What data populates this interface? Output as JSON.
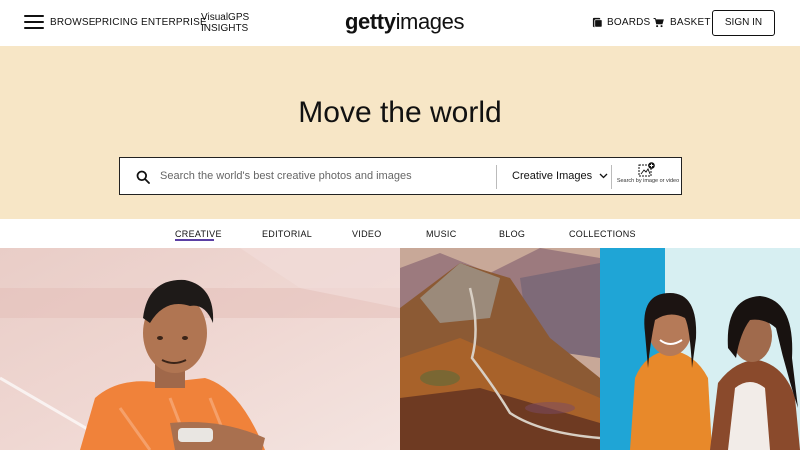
{
  "header": {
    "nav": [
      "BROWSE",
      "PRICING",
      "ENTERPRISE"
    ],
    "visual_gps": [
      "VisualGPS",
      "INSIGHTS"
    ],
    "logo_bold": "getty",
    "logo_light": "images",
    "boards_label": "BOARDS",
    "basket_label": "BASKET",
    "sign_in_label": "SIGN IN"
  },
  "hero": {
    "title": "Move the world",
    "search_placeholder": "Search the world's best creative photos and images",
    "search_type": "Creative Images",
    "image_search_label": "Search by image or video"
  },
  "tabs": [
    "CREATIVE",
    "EDITORIAL",
    "VIDEO",
    "MUSIC",
    "BLOG",
    "COLLECTIONS"
  ],
  "active_tab": "CREATIVE",
  "colors": {
    "hero_background": "#f7e6c6",
    "active_tab_underline": "#5b3fa3"
  }
}
